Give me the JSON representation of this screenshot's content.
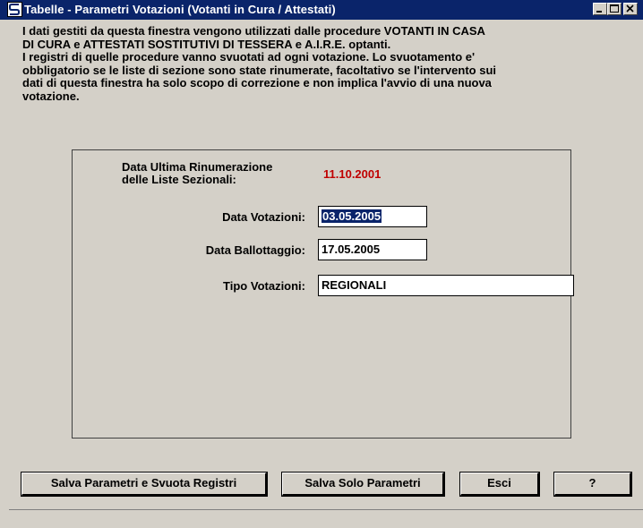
{
  "window": {
    "title": "Tabelle - Parametri Votazioni (Votanti in Cura / Attestati)",
    "icon": "app-s-icon"
  },
  "intro": {
    "lines": [
      "I dati gestiti da questa finestra vengono utilizzati dalle procedure VOTANTI IN CASA",
      "DI CURA e ATTESTATI SOSTITUTIVI DI TESSERA e A.I.R.E. optanti.",
      "I registri di quelle procedure vanno svuotati ad ogni votazione. Lo svuotamento e'",
      "obbligatorio se le liste di sezione sono state rinumerate, facoltativo se l'intervento sui",
      "dati di questa finestra ha solo scopo di correzione e non implica l'avvio di una nuova",
      "votazione."
    ]
  },
  "form": {
    "renum_label_line1": "Data Ultima Rinumerazione",
    "renum_label_line2": "delle Liste Sezionali:",
    "renum_value": "11.10.2001",
    "data_votazioni_label": "Data Votazioni:",
    "data_votazioni_value": "03.05.2005",
    "data_ballottaggio_label": "Data Ballottaggio:",
    "data_ballottaggio_value": "17.05.2005",
    "tipo_votazioni_label": "Tipo Votazioni:",
    "tipo_votazioni_value": "REGIONALI"
  },
  "buttons": {
    "save_and_clear": "Salva Parametri e Svuota Registri",
    "save_only": "Salva Solo Parametri",
    "exit": "Esci",
    "help": "?"
  },
  "colors": {
    "titlebar": "#0a246a",
    "window": "#d4d0c8",
    "renum_value": "#c00000"
  }
}
